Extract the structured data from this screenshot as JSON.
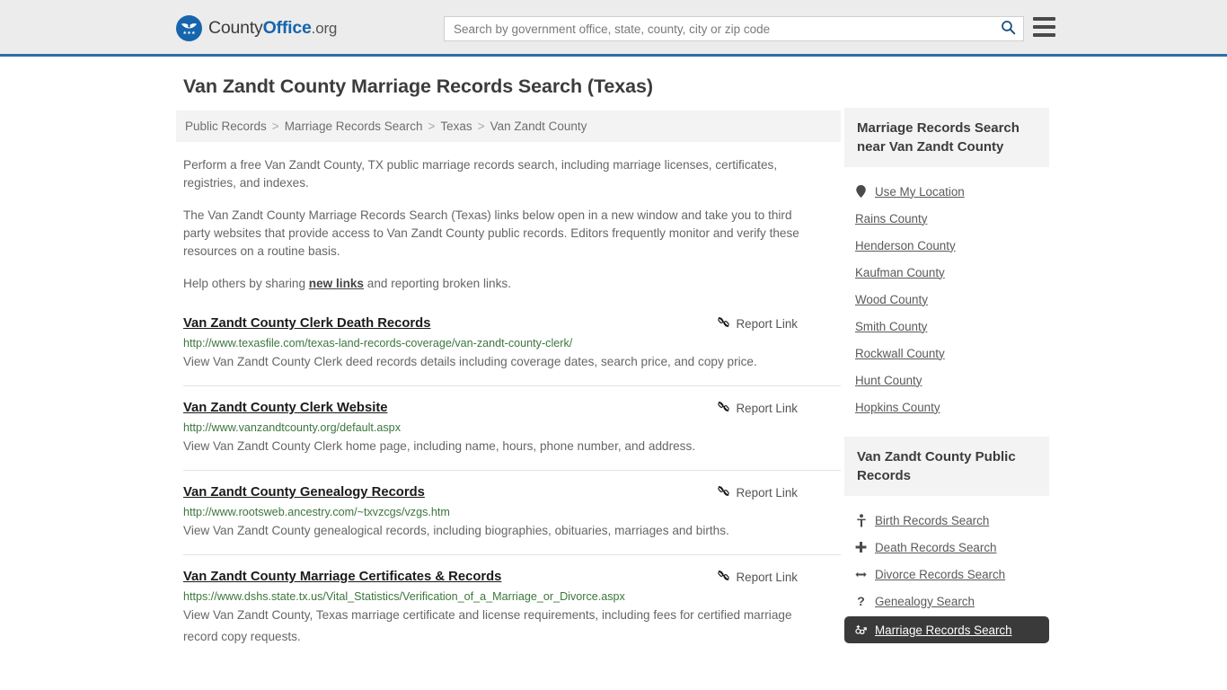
{
  "header": {
    "brand": {
      "part1": "County",
      "part2": "Office",
      "part3": ".org",
      "logo_icon": "eagle-stars-seal-icon"
    },
    "search": {
      "placeholder": "Search by government office, state, county, city or zip code",
      "value": "",
      "button_icon": "search-icon"
    },
    "menu_icon": "hamburger-menu-icon",
    "accent_color": "#2e6da4"
  },
  "main": {
    "title": "Van Zandt County Marriage Records Search (Texas)",
    "breadcrumb": [
      {
        "label": "Public Records"
      },
      {
        "label": "Marriage Records Search"
      },
      {
        "label": "Texas"
      },
      {
        "label": "Van Zandt County"
      }
    ],
    "breadcrumb_separator": ">",
    "intro": {
      "p1": "Perform a free Van Zandt County, TX public marriage records search, including marriage licenses, certificates, registries, and indexes.",
      "p2": "The Van Zandt County Marriage Records Search (Texas) links below open in a new window and take you to third party websites that provide access to Van Zandt County public records. Editors frequently monitor and verify these resources on a routine basis.",
      "p3_before": "Help others by sharing ",
      "p3_link": "new links",
      "p3_after": " and reporting broken links."
    },
    "report_link_label": "Report Link",
    "report_link_icon": "broken-link-icon",
    "results": [
      {
        "title": "Van Zandt County Clerk Death Records",
        "url": "http://www.texasfile.com/texas-land-records-coverage/van-zandt-county-clerk/",
        "description": "View Van Zandt County Clerk deed records details including coverage dates, search price, and copy price."
      },
      {
        "title": "Van Zandt County Clerk Website",
        "url": "http://www.vanzandtcounty.org/default.aspx",
        "description": "View Van Zandt County Clerk home page, including name, hours, phone number, and address."
      },
      {
        "title": "Van Zandt County Genealogy Records",
        "url": "http://www.rootsweb.ancestry.com/~txvzcgs/vzgs.htm",
        "description": "View Van Zandt County genealogical records, including biographies, obituaries, marriages and births."
      },
      {
        "title": "Van Zandt County Marriage Certificates & Records",
        "url": "https://www.dshs.state.tx.us/Vital_Statistics/Verification_of_a_Marriage_or_Divorce.aspx",
        "description": "View Van Zandt County, Texas marriage certificate and license requirements, including fees for certified marriage record copy requests."
      }
    ]
  },
  "sidebar": {
    "widgets": [
      {
        "title": "Marriage Records Search near Van Zandt County",
        "items": [
          {
            "label": "Use My Location",
            "icon": "map-pin-icon",
            "active": false
          },
          {
            "label": "Rains County",
            "icon": "",
            "active": false
          },
          {
            "label": "Henderson County",
            "icon": "",
            "active": false
          },
          {
            "label": "Kaufman County",
            "icon": "",
            "active": false
          },
          {
            "label": "Wood County",
            "icon": "",
            "active": false
          },
          {
            "label": "Smith County",
            "icon": "",
            "active": false
          },
          {
            "label": "Rockwall County",
            "icon": "",
            "active": false
          },
          {
            "label": "Hunt County",
            "icon": "",
            "active": false
          },
          {
            "label": "Hopkins County",
            "icon": "",
            "active": false
          }
        ]
      },
      {
        "title": "Van Zandt County Public Records",
        "items": [
          {
            "label": "Birth Records Search",
            "icon": "baby-icon",
            "active": false
          },
          {
            "label": "Death Records Search",
            "icon": "cross-icon",
            "active": false
          },
          {
            "label": "Divorce Records Search",
            "icon": "left-right-arrow-icon",
            "active": false
          },
          {
            "label": "Genealogy Search",
            "icon": "question-mark-icon",
            "active": false
          },
          {
            "label": "Marriage Records Search",
            "icon": "gender-symbols-icon",
            "active": true
          }
        ]
      }
    ],
    "active_bg_color": "#3a3a3a"
  }
}
